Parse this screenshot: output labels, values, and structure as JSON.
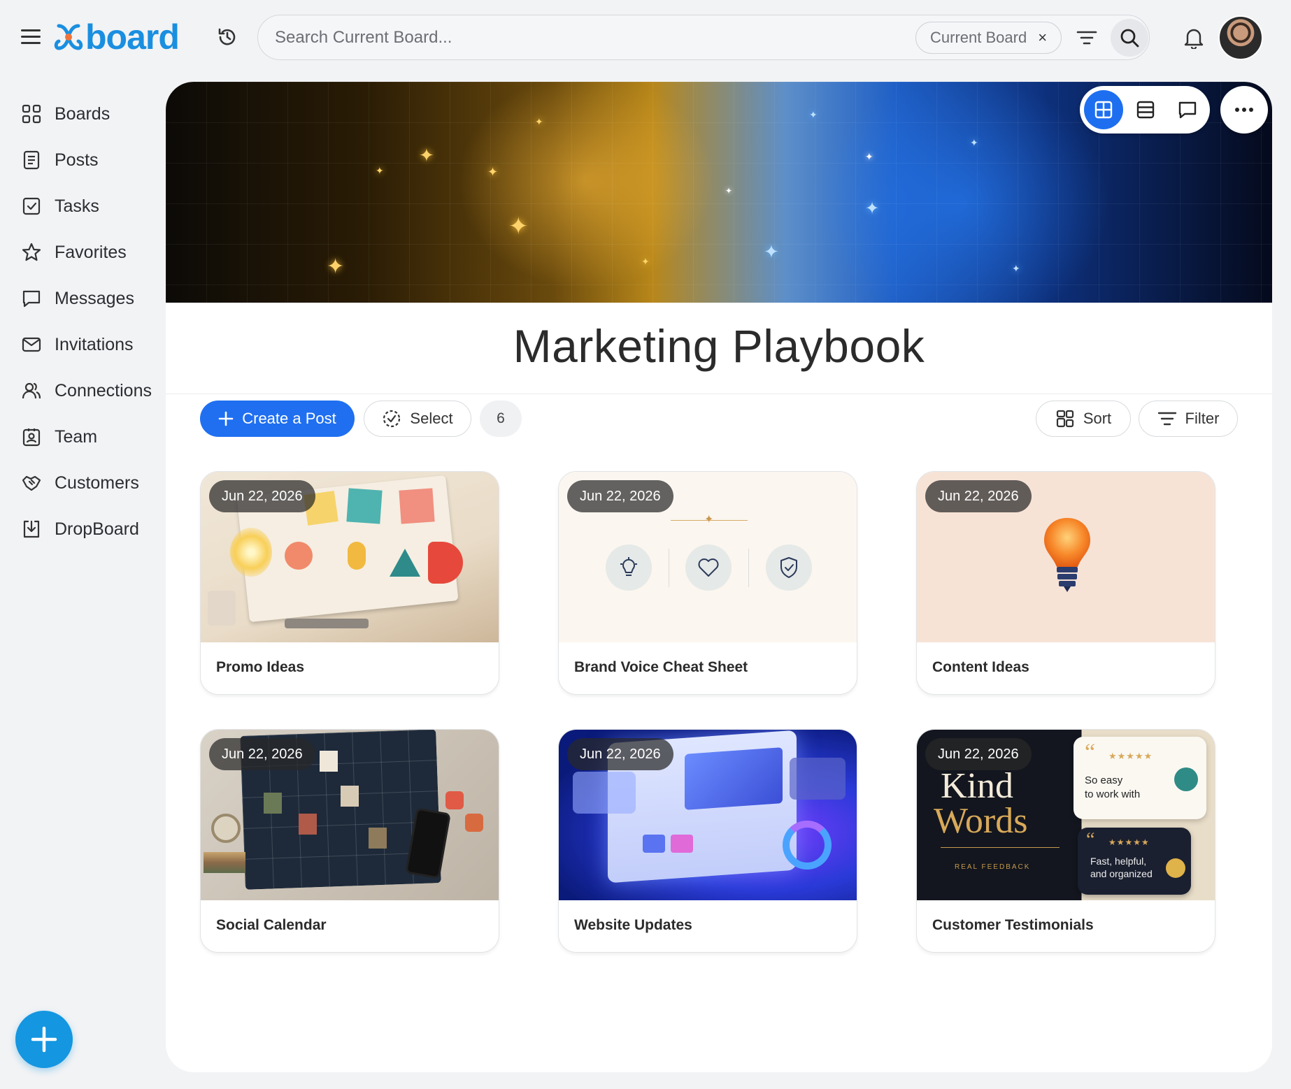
{
  "app": {
    "logo_text": "board",
    "brand_color": "#1a8fe0",
    "accent_color": "#1f6ff0"
  },
  "search": {
    "placeholder": "Search Current Board...",
    "scope_chip": "Current Board",
    "scope_close": "×"
  },
  "sidebar": {
    "items": [
      {
        "label": "Boards",
        "icon": "grid-icon"
      },
      {
        "label": "Posts",
        "icon": "document-icon"
      },
      {
        "label": "Tasks",
        "icon": "checkbox-icon"
      },
      {
        "label": "Favorites",
        "icon": "star-icon"
      },
      {
        "label": "Messages",
        "icon": "chat-bubble-icon"
      },
      {
        "label": "Invitations",
        "icon": "envelope-icon"
      },
      {
        "label": "Connections",
        "icon": "people-icon"
      },
      {
        "label": "Team",
        "icon": "id-badge-icon"
      },
      {
        "label": "Customers",
        "icon": "handshake-icon"
      },
      {
        "label": "DropBoard",
        "icon": "download-box-icon"
      }
    ]
  },
  "board": {
    "title": "Marketing Playbook",
    "view_mode": "grid"
  },
  "toolbar": {
    "create_label": "Create a Post",
    "select_label": "Select",
    "post_count": "6",
    "sort_label": "Sort",
    "filter_label": "Filter"
  },
  "cards": [
    {
      "date": "Jun 22, 2026",
      "title": "Promo Ideas"
    },
    {
      "date": "Jun 22, 2026",
      "title": "Brand Voice Cheat Sheet"
    },
    {
      "date": "Jun 22, 2026",
      "title": "Content Ideas"
    },
    {
      "date": "Jun 22, 2026",
      "title": "Social Calendar"
    },
    {
      "date": "Jun 22, 2026",
      "title": "Website Updates"
    },
    {
      "date": "Jun 22, 2026",
      "title": "Customer Testimonials"
    }
  ],
  "testimonial_art": {
    "headline_line1": "Kind",
    "headline_line2": "Words",
    "tagline": "REAL FEEDBACK",
    "quote1_line1": "So easy",
    "quote1_line2": "to work with",
    "quote2_line1": "Fast, helpful,",
    "quote2_line2": "and organized",
    "rating": "★★★★★"
  }
}
